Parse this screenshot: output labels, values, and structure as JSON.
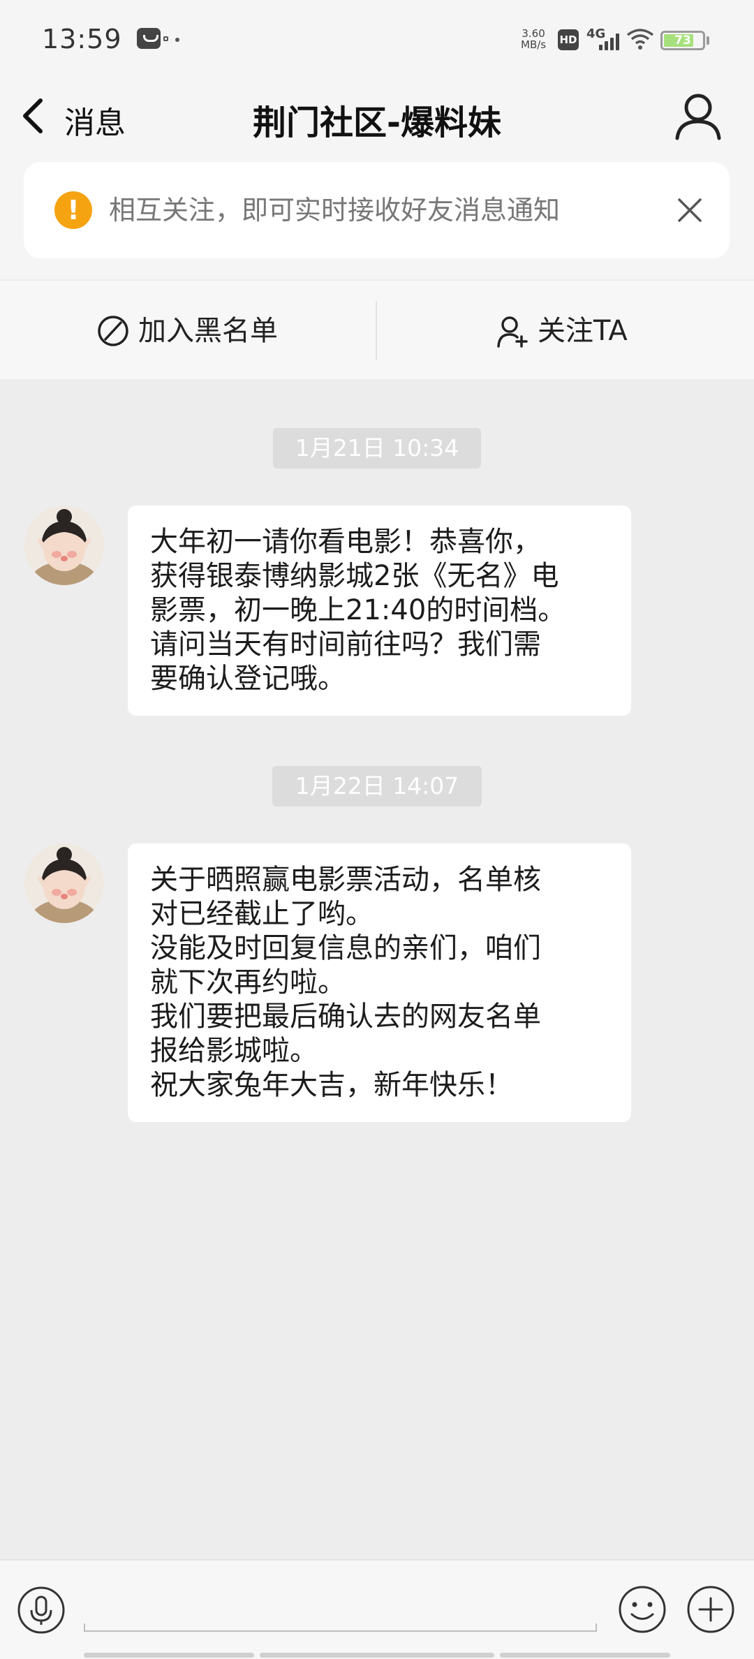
{
  "status_bar": {
    "time": "13:59",
    "net_speed_value": "3.60",
    "net_speed_unit": "MB/s",
    "hd_badge": "HD",
    "network": "4G",
    "battery_level": "73",
    "battery_fraction": 0.73
  },
  "nav": {
    "back_label": "消息",
    "title": "荆门社区-爆料妹"
  },
  "notice": {
    "text": "相互关注，即可实时接收好友消息通知"
  },
  "actions": {
    "blacklist_label": "加入黑名单",
    "follow_label": "关注TA"
  },
  "chat": {
    "messages": [
      {
        "timestamp": "1月21日 10:34",
        "lines": [
          "大年初一请你看电影！恭喜你，",
          "获得银泰博纳影城2张《无名》电",
          "影票，初一晚上21:40的时间档。",
          "请问当天有时间前往吗？我们需",
          "要确认登记哦。"
        ]
      },
      {
        "timestamp": "1月22日 14:07",
        "lines": [
          "关于晒照赢电影票活动，名单核",
          "对已经截止了哟。",
          "没能及时回复信息的亲们，咱们",
          "就下次再约啦。",
          "我们要把最后确认去的网友名单",
          "报给影城啦。",
          "祝大家兔年大吉，新年快乐！"
        ]
      }
    ]
  },
  "colors": {
    "accent_warning": "#f6a312",
    "chat_background": "#ededed",
    "bubble": "#ffffff",
    "timestamp_pill": "#dcdcdc"
  },
  "icons": {
    "back": "chevron-left-icon",
    "user": "user-icon",
    "warning": "exclamation-icon",
    "close": "close-icon",
    "block": "block-icon",
    "follow": "add-user-icon",
    "voice": "microphone-icon",
    "emoji": "emoji-icon",
    "more": "plus-icon"
  }
}
